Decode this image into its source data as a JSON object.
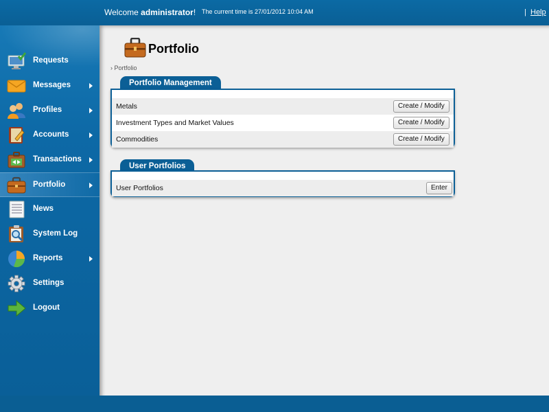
{
  "header": {
    "welcome_prefix": "Welcome ",
    "username": "administrator",
    "welcome_suffix": "!",
    "current_time": "The current time is 27/01/2012 10:04 AM",
    "help_separator": "|",
    "help_label": "Help"
  },
  "sidebar": {
    "items": [
      {
        "label": "Requests",
        "icon": "monitor-check-icon",
        "has_submenu": false
      },
      {
        "label": "Messages",
        "icon": "envelope-icon",
        "has_submenu": true
      },
      {
        "label": "Profiles",
        "icon": "users-icon",
        "has_submenu": true
      },
      {
        "label": "Accounts",
        "icon": "ledger-icon",
        "has_submenu": true
      },
      {
        "label": "Transactions",
        "icon": "transfer-icon",
        "has_submenu": true
      },
      {
        "label": "Portfolio",
        "icon": "briefcase-icon",
        "has_submenu": true,
        "active": true
      },
      {
        "label": "News",
        "icon": "document-icon",
        "has_submenu": false
      },
      {
        "label": "System Log",
        "icon": "magnifier-clipboard-icon",
        "has_submenu": false
      },
      {
        "label": "Reports",
        "icon": "pie-chart-icon",
        "has_submenu": true
      },
      {
        "label": "Settings",
        "icon": "gear-icon",
        "has_submenu": false
      },
      {
        "label": "Logout",
        "icon": "arrow-right-icon",
        "has_submenu": false
      }
    ]
  },
  "main": {
    "title": "Portfolio",
    "breadcrumb": "› Portfolio",
    "portfolio_management": {
      "tab_label": "Portfolio Management",
      "rows": [
        {
          "label": "Metals",
          "button": "Create / Modify"
        },
        {
          "label": "Investment Types and Market Values",
          "button": "Create / Modify"
        },
        {
          "label": "Commodities",
          "button": "Create / Modify"
        }
      ]
    },
    "user_portfolios": {
      "tab_label": "User Portfolios",
      "rows": [
        {
          "label": "User Portfolios",
          "button": "Enter"
        }
      ]
    }
  },
  "colors": {
    "brand_blue": "#0a5e93",
    "panel_blue": "#0b5f96",
    "content_bg": "#efefef"
  }
}
